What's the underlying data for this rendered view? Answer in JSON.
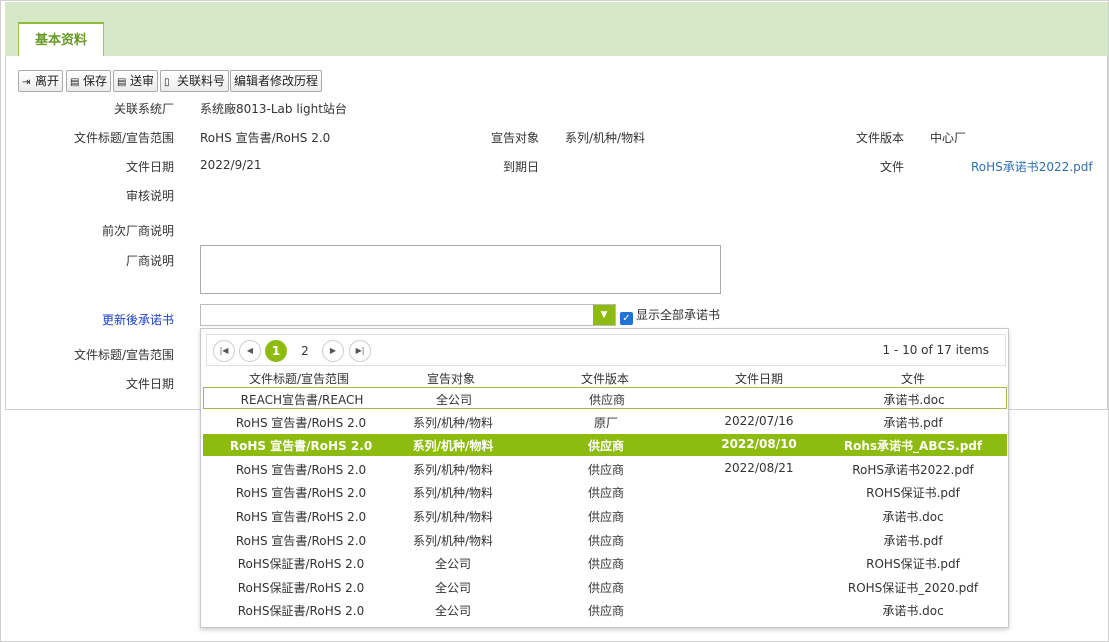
{
  "tab": {
    "label": "基本资料"
  },
  "toolbar": [
    {
      "icon": "exit-icon",
      "glyph": "⇥",
      "label": "离开"
    },
    {
      "icon": "save-icon",
      "glyph": "▤",
      "label": "保存"
    },
    {
      "icon": "send-review-icon",
      "glyph": "▤",
      "label": "送审"
    },
    {
      "icon": "link-doc-icon",
      "glyph": "▯",
      "label": "关联料号"
    },
    {
      "icon": "",
      "glyph": "",
      "label": "编辑者修改历程"
    }
  ],
  "form": {
    "related_factory_label": "关联系统厂",
    "related_factory_value": "系统廠8013-Lab light站台",
    "doc_title_label": "文件标题/宣告范围",
    "doc_title_value": "RoHS 宣告書/RoHS 2.0",
    "declare_target_label": "宣告对象",
    "declare_target_value": "系列/机种/物料",
    "doc_version_label": "文件版本",
    "doc_version_value": "中心厂",
    "doc_date_label": "文件日期",
    "doc_date_value": "2022/9/21",
    "expiry_label": "到期日",
    "file_label": "文件",
    "file_value": "RoHS承诺书2022.pdf",
    "review_note_label": "审核说明",
    "prev_vendor_note_label": "前次厂商说明",
    "vendor_note_label": "厂商说明",
    "updated_commit_label": "更新後承诺书",
    "show_all_label": "显示全部承诺书",
    "doc_title_label2": "文件标题/宣告范围",
    "doc_date_label2": "文件日期"
  },
  "pager": {
    "current": "1",
    "page2": "2",
    "info": "1 - 10 of 17 items"
  },
  "grid": {
    "columns": [
      "文件标题/宣告范围",
      "宣告对象",
      "文件版本",
      "文件日期",
      "文件"
    ],
    "rows": [
      [
        "REACH宣告書/REACH",
        "全公司",
        "供应商",
        "",
        "承诺书.doc"
      ],
      [
        "RoHS 宣告書/RoHS 2.0",
        "系列/机种/物料",
        "原厂",
        "2022/07/16",
        "承诺书.pdf"
      ],
      [
        "RoHS 宣告書/RoHS 2.0",
        "系列/机种/物料",
        "供应商",
        "2022/08/10",
        "Rohs承诺书_ABCS.pdf"
      ],
      [
        "RoHS 宣告書/RoHS 2.0",
        "系列/机种/物料",
        "供应商",
        "2022/08/21",
        "RoHS承诺书2022.pdf"
      ],
      [
        "RoHS 宣告書/RoHS 2.0",
        "系列/机种/物料",
        "供应商",
        "",
        "ROHS保证书.pdf"
      ],
      [
        "RoHS 宣告書/RoHS 2.0",
        "系列/机种/物料",
        "供应商",
        "",
        "承诺书.doc"
      ],
      [
        "RoHS 宣告書/RoHS 2.0",
        "系列/机种/物料",
        "供应商",
        "",
        "承诺书.pdf"
      ],
      [
        "RoHS保証書/RoHS 2.0",
        "全公司",
        "供应商",
        "",
        "ROHS保证书.pdf"
      ],
      [
        "RoHS保証書/RoHS 2.0",
        "全公司",
        "供应商",
        "",
        "ROHS保证书_2020.pdf"
      ],
      [
        "RoHS保証書/RoHS 2.0",
        "全公司",
        "供应商",
        "",
        "承诺书.doc"
      ]
    ],
    "selected_row": 2,
    "focused_row": 0
  },
  "colors": {
    "accent": "#8dbb0f",
    "tab_bar": "#d6e8c8",
    "link": "#2f6fb0"
  }
}
